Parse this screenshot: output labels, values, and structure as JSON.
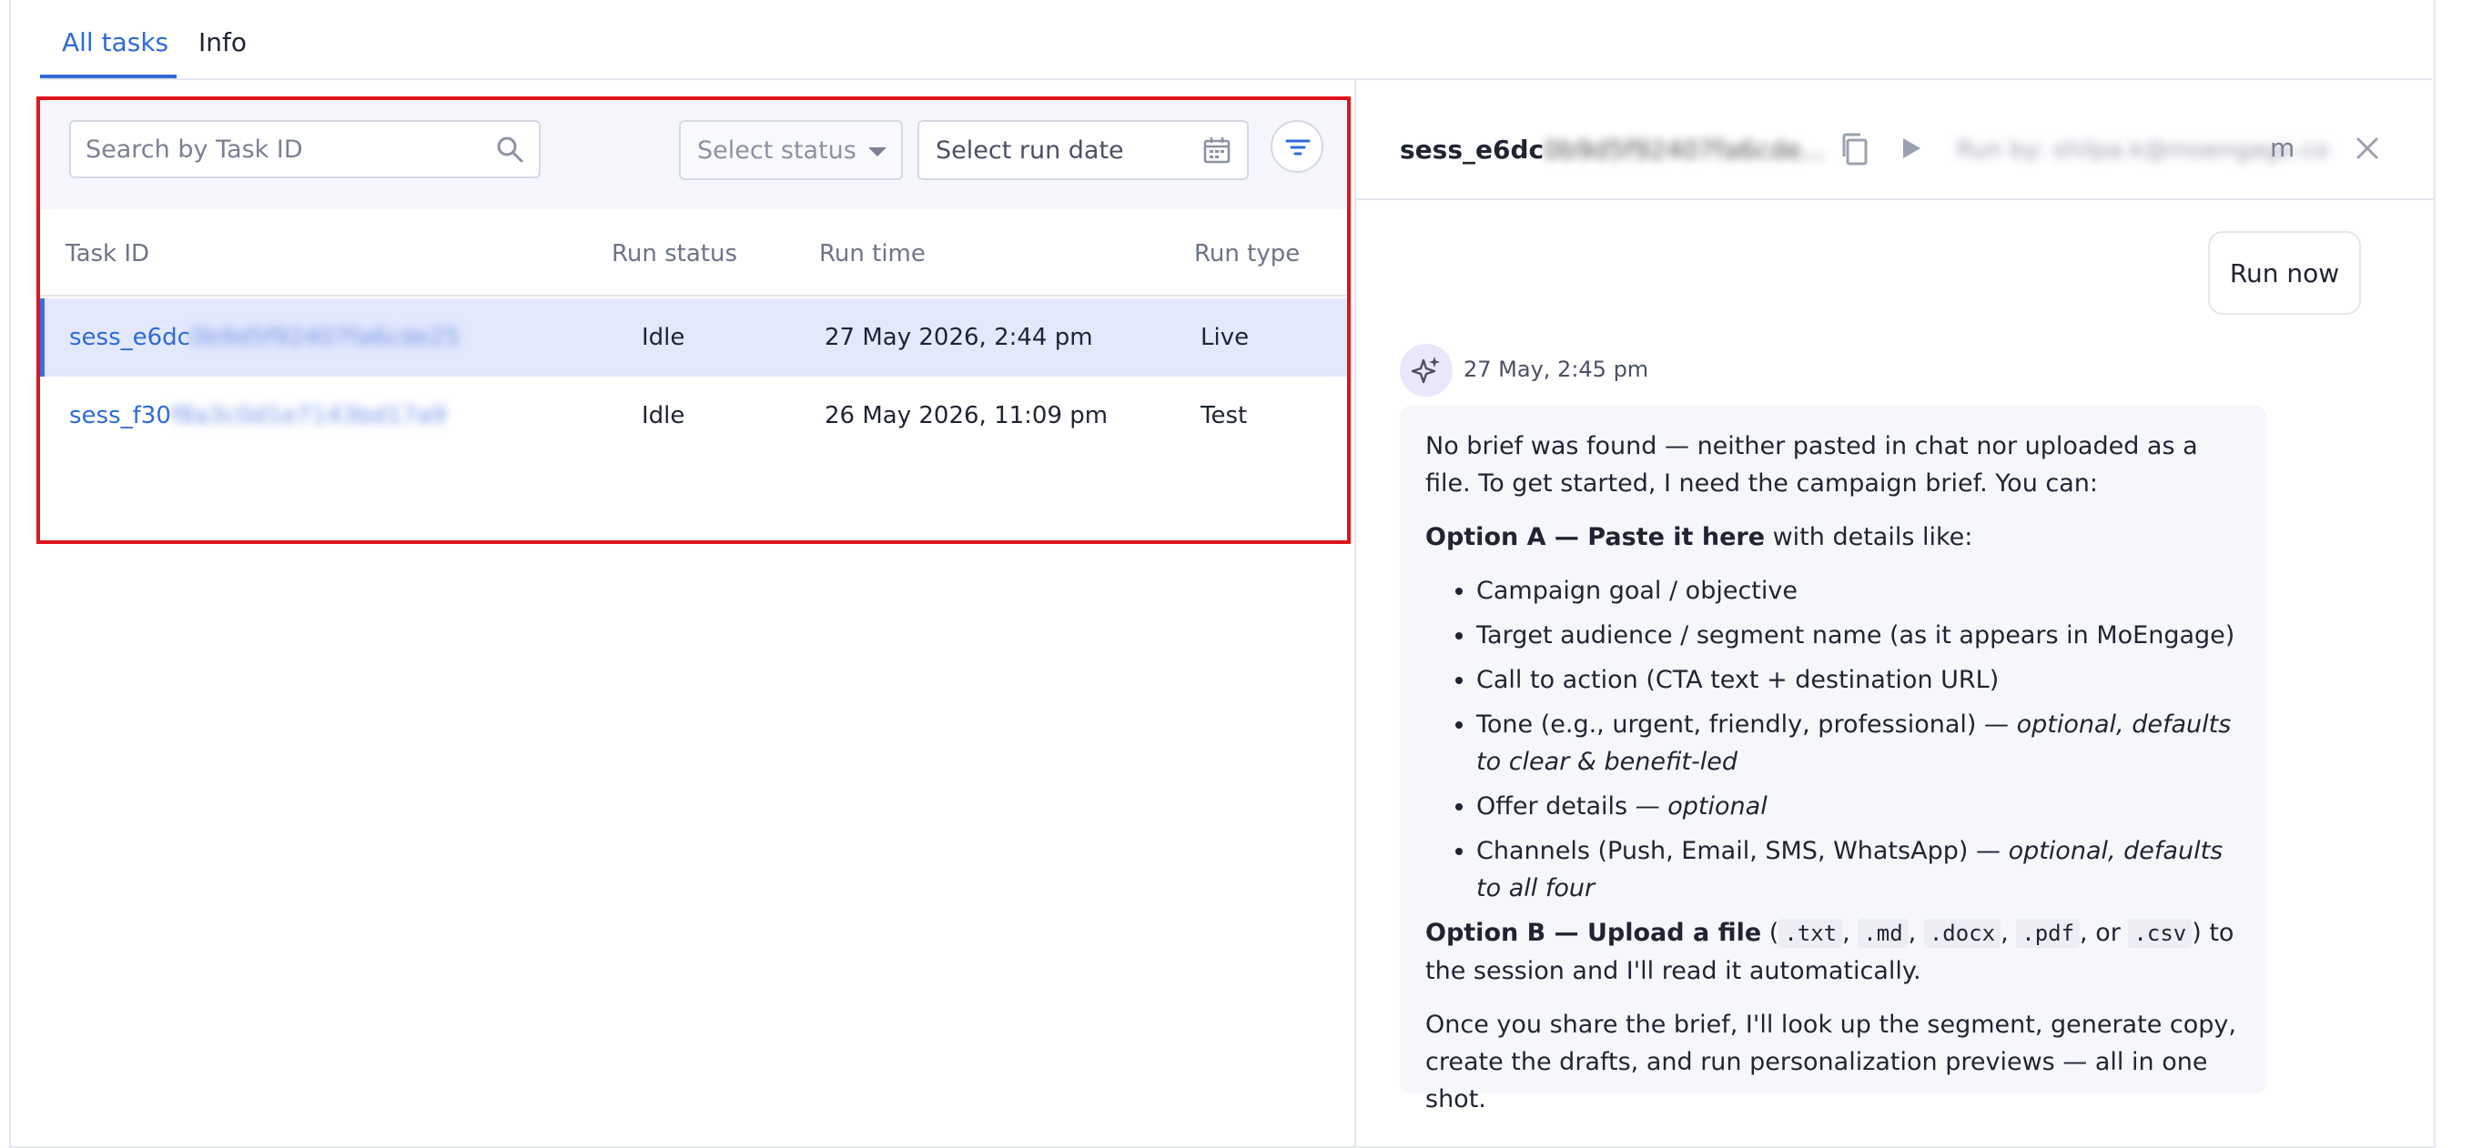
{
  "tabs": [
    {
      "label": "All tasks",
      "active": true
    },
    {
      "label": "Info",
      "active": false
    }
  ],
  "filters": {
    "search_placeholder": "Search by Task ID",
    "status_placeholder": "Select status",
    "date_placeholder": "Select run date",
    "search_icon": "search-icon",
    "calendar_icon": "calendar-icon",
    "filter_icon": "filter-icon"
  },
  "table": {
    "columns": [
      "Task ID",
      "Run status",
      "Run time",
      "Run type"
    ],
    "rows": [
      {
        "task_id_visible": "sess_e6dc",
        "task_id_hidden": "0b9d5f92407fa6cde25",
        "run_status": "Idle",
        "run_time": "27 May 2026, 2:44 pm",
        "run_type": "Live",
        "selected": true
      },
      {
        "task_id_visible": "sess_f30",
        "task_id_hidden": "f8a3c0d1e7143bd17a9",
        "run_status": "Idle",
        "run_time": "26 May 2026, 11:09 pm",
        "run_type": "Test",
        "selected": false
      }
    ]
  },
  "detail": {
    "session_visible": "sess_e6dc",
    "session_hidden": "0b9d5f92407fa6cde...",
    "run_by_hidden": "Run by: shilpa.k@moengage.co",
    "run_by_end": "m",
    "run_now_label": "Run now",
    "message": {
      "timestamp": "27 May, 2:45 pm",
      "intro": "No brief was found — neither pasted in chat nor uploaded as a file. To get started, I need the campaign brief. You can:",
      "option_a_title": "Option A — Paste it here",
      "option_a_suffix": " with details like:",
      "items": [
        {
          "text": "Campaign goal / objective",
          "note": ""
        },
        {
          "text": "Target audience / segment name (as it appears in MoEngage)",
          "note": ""
        },
        {
          "text": "Call to action (CTA text + destination URL)",
          "note": ""
        },
        {
          "text": "Tone (e.g., urgent, friendly, professional) — ",
          "note": "optional, defaults to clear & benefit-led"
        },
        {
          "text": "Offer details — ",
          "note": "optional"
        },
        {
          "text": "Channels (Push, Email, SMS, WhatsApp) — ",
          "note": "optional, defaults to all four"
        }
      ],
      "option_b_title": "Option B — Upload a file",
      "option_b_open": " (",
      "file_types": [
        ".txt",
        ".md",
        ".docx",
        ".pdf",
        ".csv"
      ],
      "option_b_tail": ") to the session and I'll read it automatically.",
      "closing": "Once you share the brief, I'll look up the segment, generate copy, create the drafts, and run personalization previews — all in one shot."
    }
  },
  "colors": {
    "accent": "#2f6ad8",
    "selected_row": "#e3e8fd",
    "highlight": "#e0141a"
  }
}
